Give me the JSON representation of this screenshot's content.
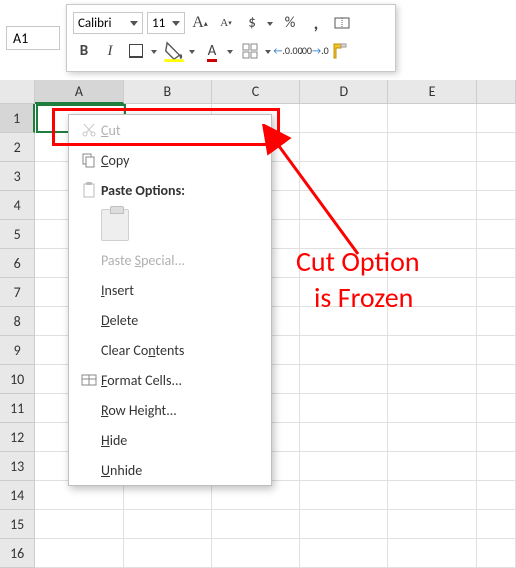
{
  "namebox": {
    "value": "A1"
  },
  "toolbar": {
    "font": "Calibri",
    "size": "11"
  },
  "columns": [
    "A",
    "B",
    "C",
    "D",
    "E"
  ],
  "rows": [
    "1",
    "2",
    "3",
    "4",
    "5",
    "6",
    "7",
    "8",
    "9",
    "10",
    "11",
    "12",
    "13",
    "14",
    "15",
    "16"
  ],
  "context_menu": {
    "cut": "Cut",
    "copy": "Copy",
    "paste_options": "Paste Options:",
    "paste_special": "Paste Special...",
    "insert": "Insert",
    "delete": "Delete",
    "clear": "Clear Contents",
    "format_cells": "Format Cells...",
    "row_height": "Row Height...",
    "hide": "Hide",
    "unhide": "Unhide"
  },
  "annotation": {
    "line1": "Cut Option",
    "line2": "is Frozen"
  }
}
